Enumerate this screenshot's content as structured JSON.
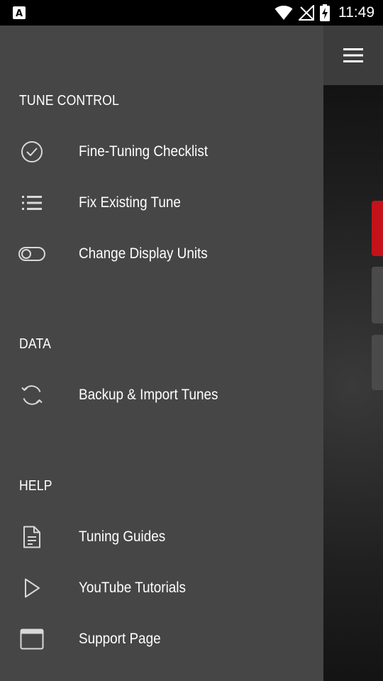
{
  "status_bar": {
    "time": "11:49",
    "icons": [
      "a-notification-icon",
      "wifi-icon",
      "no-signal-icon",
      "battery-charging-icon"
    ]
  },
  "drawer": {
    "sections": [
      {
        "header": "TUNE CONTROL",
        "items": [
          {
            "label": "Fine-Tuning Checklist",
            "icon": "check-circle-icon"
          },
          {
            "label": "Fix Existing Tune",
            "icon": "list-icon"
          },
          {
            "label": "Change Display Units",
            "icon": "toggle-icon"
          }
        ]
      },
      {
        "header": "DATA",
        "items": [
          {
            "label": "Backup & Import Tunes",
            "icon": "sync-icon"
          }
        ]
      },
      {
        "header": "HELP",
        "items": [
          {
            "label": "Tuning Guides",
            "icon": "document-icon"
          },
          {
            "label": "YouTube Tutorials",
            "icon": "play-icon"
          },
          {
            "label": "Support Page",
            "icon": "browser-window-icon"
          }
        ]
      }
    ]
  },
  "app": {
    "menu_icon": "hamburger-menu-icon",
    "accent_color": "#c4121a",
    "drawer_color": "#464646"
  }
}
